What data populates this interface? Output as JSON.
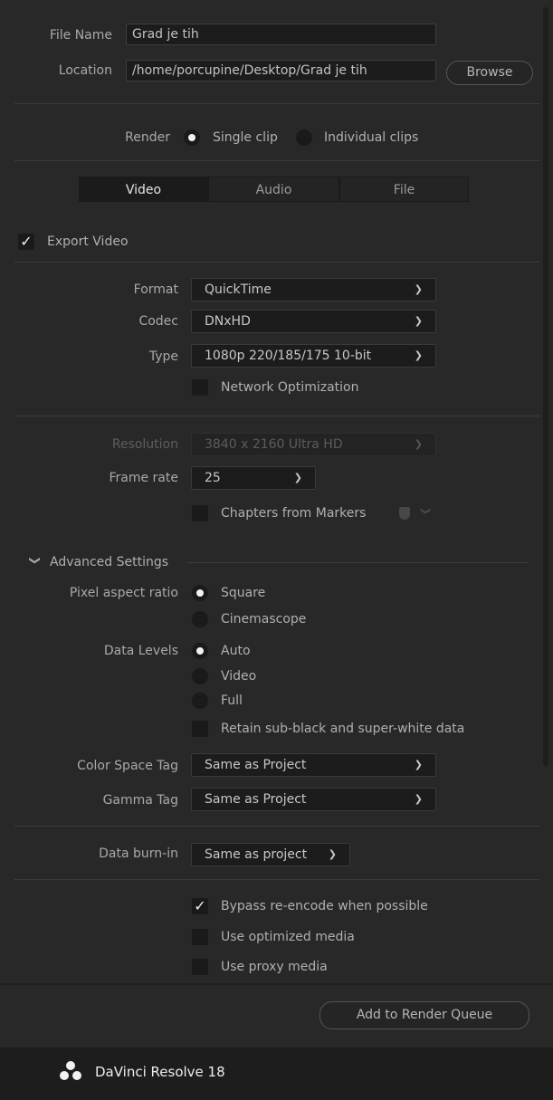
{
  "file": {
    "name_label": "File Name",
    "name_value": "Grad je tih",
    "location_label": "Location",
    "location_value": "/home/porcupine/Desktop/Grad je tih",
    "browse_label": "Browse"
  },
  "render": {
    "label": "Render",
    "options": [
      "Single clip",
      "Individual clips"
    ],
    "selected": "Single clip"
  },
  "tabs": [
    "Video",
    "Audio",
    "File"
  ],
  "active_tab": "Video",
  "export_video": {
    "label": "Export Video",
    "checked": true
  },
  "format": {
    "label": "Format",
    "value": "QuickTime"
  },
  "codec": {
    "label": "Codec",
    "value": "DNxHD"
  },
  "type": {
    "label": "Type",
    "value": "1080p 220/185/175 10-bit"
  },
  "network_opt": {
    "label": "Network Optimization",
    "checked": false
  },
  "resolution": {
    "label": "Resolution",
    "value": "3840 x 2160 Ultra HD",
    "disabled": true
  },
  "frame_rate": {
    "label": "Frame rate",
    "value": "25"
  },
  "chapters": {
    "label": "Chapters from Markers",
    "checked": false
  },
  "advanced": {
    "title": "Advanced Settings",
    "pixel_aspect": {
      "label": "Pixel aspect ratio",
      "options": [
        "Square",
        "Cinemascope"
      ],
      "selected": "Square"
    },
    "data_levels": {
      "label": "Data Levels",
      "options": [
        "Auto",
        "Video",
        "Full"
      ],
      "selected": "Auto"
    },
    "retain_label": "Retain sub-black and super-white data",
    "color_space": {
      "label": "Color Space Tag",
      "value": "Same as Project"
    },
    "gamma": {
      "label": "Gamma Tag",
      "value": "Same as Project"
    }
  },
  "burn_in": {
    "label": "Data burn-in",
    "value": "Same as project"
  },
  "checks": {
    "bypass": {
      "label": "Bypass re-encode when possible",
      "checked": true
    },
    "optimized": {
      "label": "Use optimized media",
      "checked": false
    },
    "proxy": {
      "label": "Use proxy media",
      "checked": false
    }
  },
  "add_queue_label": "Add to Render Queue",
  "app_name": "DaVinci Resolve 18"
}
